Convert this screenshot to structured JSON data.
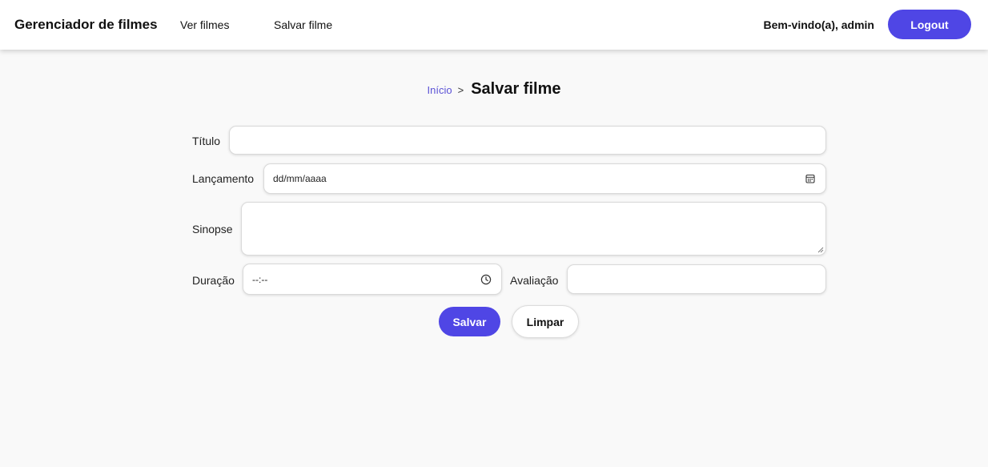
{
  "header": {
    "brand": "Gerenciador de filmes",
    "nav": [
      {
        "label": "Ver filmes"
      },
      {
        "label": "Salvar filme"
      }
    ],
    "welcome": "Bem-vindo(a), admin",
    "logout_label": "Logout"
  },
  "breadcrumb": {
    "home": "Início",
    "separator": ">",
    "current": "Salvar filme"
  },
  "form": {
    "titulo": {
      "label": "Título",
      "value": ""
    },
    "lancamento": {
      "label": "Lançamento",
      "placeholder": "dd/mm/aaaa",
      "icon": "calendar-icon"
    },
    "sinopse": {
      "label": "Sinopse",
      "value": ""
    },
    "duracao": {
      "label": "Duração",
      "placeholder": "--:--",
      "icon": "clock-icon"
    },
    "avaliacao": {
      "label": "Avaliação",
      "value": ""
    },
    "save_label": "Salvar",
    "clear_label": "Limpar"
  },
  "colors": {
    "accent": "#4f46e5",
    "link": "#5b52d6",
    "background": "#f9f9f9"
  }
}
